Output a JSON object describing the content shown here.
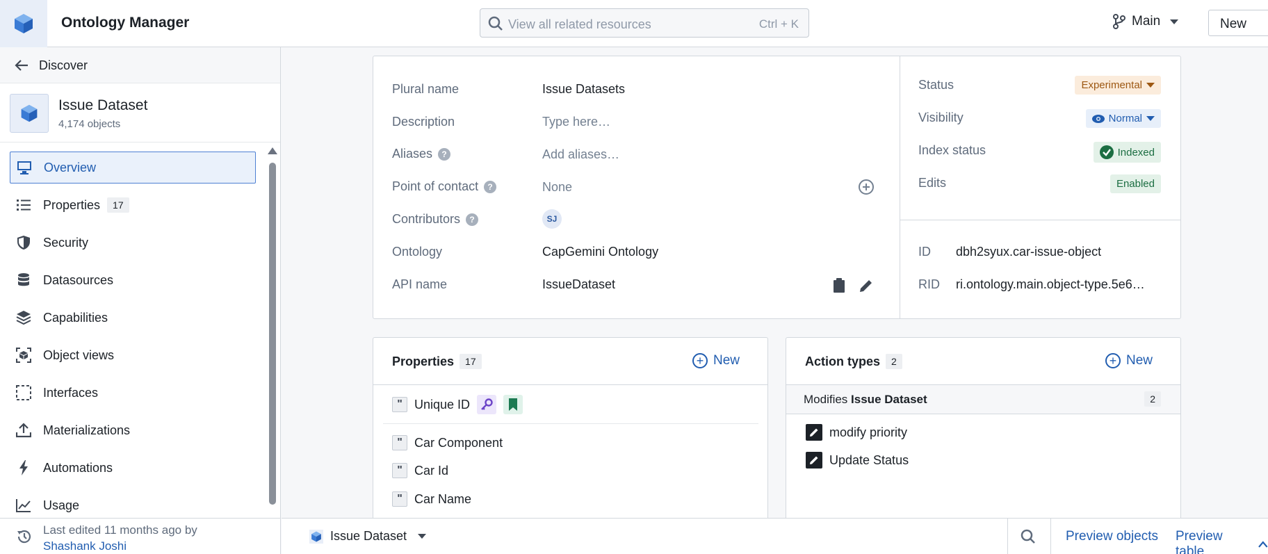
{
  "app": {
    "title": "Ontology Manager"
  },
  "search": {
    "placeholder": "View all related resources",
    "shortcut": "Ctrl + K"
  },
  "branch": {
    "label": "Main"
  },
  "topbar": {
    "new_label": "New"
  },
  "sidebar": {
    "discover_label": "Discover",
    "object": {
      "name": "Issue Dataset",
      "count": "4,174 objects"
    },
    "items": [
      {
        "label": "Overview",
        "icon": "monitor-icon",
        "active": true
      },
      {
        "label": "Properties",
        "icon": "list-icon",
        "badge": "17"
      },
      {
        "label": "Security",
        "icon": "shield-icon"
      },
      {
        "label": "Datasources",
        "icon": "database-icon"
      },
      {
        "label": "Capabilities",
        "icon": "layers-icon"
      },
      {
        "label": "Object views",
        "icon": "object-view-icon"
      },
      {
        "label": "Interfaces",
        "icon": "interface-icon"
      },
      {
        "label": "Materializations",
        "icon": "upload-icon"
      },
      {
        "label": "Automations",
        "icon": "lightning-icon"
      },
      {
        "label": "Usage",
        "icon": "chart-line-icon"
      }
    ],
    "last_edited": {
      "text": "Last edited 11 months ago by",
      "user": "Shashank Joshi"
    }
  },
  "info": {
    "rows": [
      {
        "label": "Plural name",
        "value": "Issue Datasets"
      },
      {
        "label": "Description",
        "value": "Type here…"
      },
      {
        "label": "Aliases",
        "value": "Add aliases…"
      },
      {
        "label": "Point of contact",
        "value": "None"
      },
      {
        "label": "Contributors",
        "value": "SJ"
      },
      {
        "label": "Ontology",
        "value": "CapGemini Ontology"
      },
      {
        "label": "API name",
        "value": "IssueDataset"
      }
    ],
    "status": {
      "status_label": "Status",
      "status_value": "Experimental",
      "visibility_label": "Visibility",
      "visibility_value": "Normal",
      "index_label": "Index status",
      "index_value": "Indexed",
      "edits_label": "Edits",
      "edits_value": "Enabled"
    },
    "ids": {
      "id_label": "ID",
      "id_value": "dbh2syux.car-issue-object",
      "rid_label": "RID",
      "rid_value": "ri.ontology.main.object-type.5e6…"
    }
  },
  "properties_card": {
    "title": "Properties",
    "count": "17",
    "new_label": "New",
    "items": [
      "Unique ID",
      "Car Component",
      "Car Id",
      "Car Name"
    ]
  },
  "actions_card": {
    "title": "Action types",
    "count": "2",
    "new_label": "New",
    "modifies_prefix": "Modifies",
    "modifies_object": "Issue Dataset",
    "modifies_count": "2",
    "items": [
      "modify priority",
      "Update Status"
    ]
  },
  "bottombar": {
    "object_name": "Issue Dataset",
    "preview_objects": "Preview objects",
    "preview_table": "Preview table"
  },
  "colors": {
    "accent": "#215db0",
    "brand_tile": "#4a90d9"
  }
}
